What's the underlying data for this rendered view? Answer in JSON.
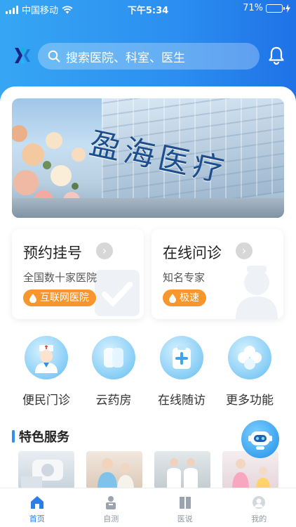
{
  "status_bar": {
    "carrier": "中国移动",
    "time": "下午5:34",
    "battery": "71%",
    "battery_level": 0.71
  },
  "header": {
    "search_placeholder": "搜索医院、科室、医生"
  },
  "cards": [
    {
      "title": "预约挂号",
      "subtitle": "全国数十家医院",
      "badge": "互联网医院"
    },
    {
      "title": "在线问诊",
      "subtitle": "知名专家",
      "badge": "极速"
    }
  ],
  "functions": [
    {
      "label": "便民门诊",
      "icon": "nurse-icon"
    },
    {
      "label": "云药房",
      "icon": "pharmacy-icon"
    },
    {
      "label": "在线随访",
      "icon": "clipboard-icon"
    },
    {
      "label": "更多功能",
      "icon": "clover-icon"
    }
  ],
  "featured": {
    "title": "特色服务"
  },
  "tabs": [
    {
      "label": "首页",
      "icon": "home-icon",
      "active": true
    },
    {
      "label": "自测",
      "icon": "self-test-icon",
      "active": false
    },
    {
      "label": "医说",
      "icon": "book-icon",
      "active": false
    },
    {
      "label": "我的",
      "icon": "profile-icon",
      "active": false
    }
  ],
  "colors": {
    "brand_blue": "#2b8ef0",
    "badge_orange": "#f6962c",
    "tab_active": "#2a7fe6",
    "tab_inactive": "#8f97a3"
  }
}
